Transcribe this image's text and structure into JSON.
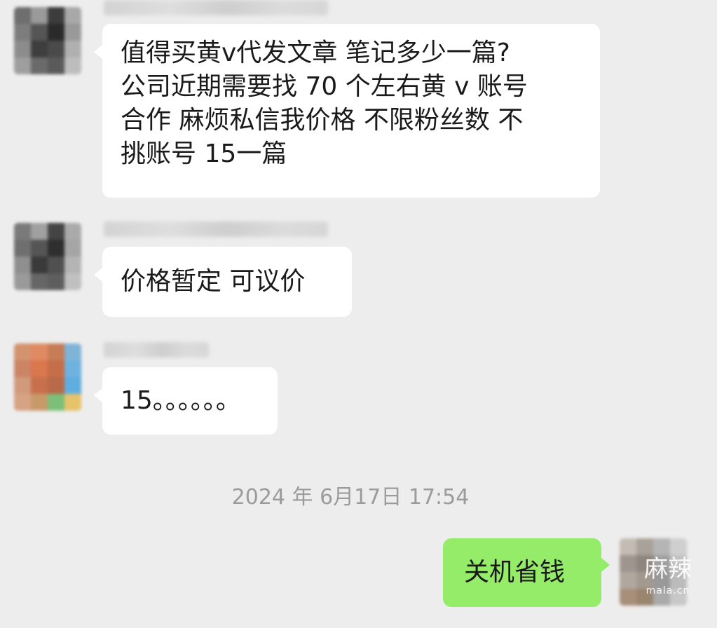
{
  "messages": [
    {
      "side": "left",
      "text": [
        "值得买黄v代发文章 笔记多少一篇?",
        "公司近期需要找 70 个左右黄 v 账号",
        "合作 麻烦私信我价格 不限粉丝数 不",
        "挑账号 15一篇"
      ]
    },
    {
      "side": "left",
      "text": [
        "价格暂定 可议价"
      ]
    },
    {
      "side": "left",
      "text": [
        "15。。。。。。"
      ]
    },
    {
      "side": "right",
      "text": [
        "关机省钱"
      ]
    }
  ],
  "timestamp": "2024 年 6月17日 17:54",
  "watermark": {
    "logo": "麻辣",
    "url": "mala.cn"
  },
  "colors": {
    "background": "#ededed",
    "bubble_incoming": "#ffffff",
    "bubble_outgoing": "#95ec69",
    "timestamp_text": "#9b9b9b"
  }
}
